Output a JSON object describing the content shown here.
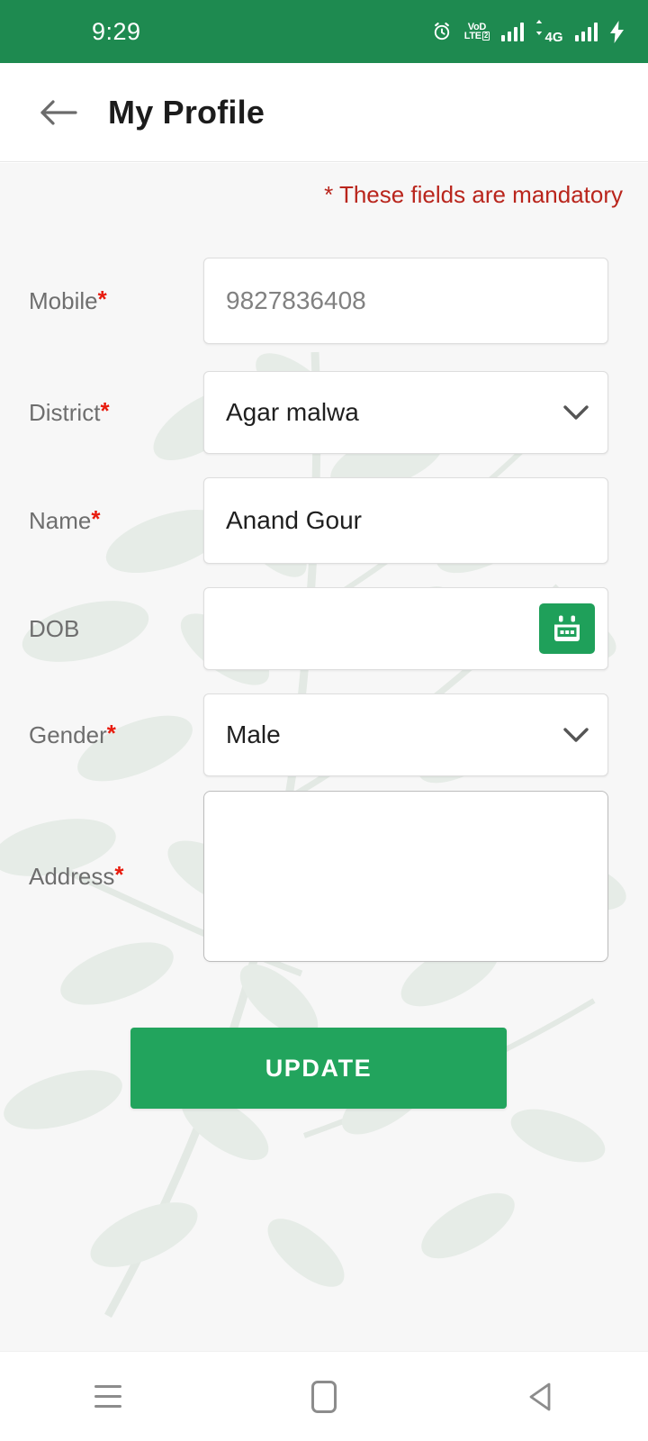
{
  "status_bar": {
    "time": "9:29",
    "background_color": "#1e8a50",
    "icons": [
      {
        "name": "alarm-icon",
        "label": "alarm"
      },
      {
        "name": "volte-icon",
        "label": "VoLTE",
        "line1": "VoD",
        "line2": "LTE",
        "badge": "2"
      },
      {
        "name": "signal-bars-sim1-icon",
        "label": "signal"
      },
      {
        "name": "network-4g-icon",
        "label": "4G"
      },
      {
        "name": "signal-bars-sim2-icon",
        "label": "signal"
      },
      {
        "name": "battery-charging-icon",
        "label": "charging"
      }
    ]
  },
  "app_bar": {
    "back_label": "back",
    "title": "My Profile"
  },
  "content": {
    "mandatory_note": "* These fields are mandatory",
    "note_color": "#b9251c"
  },
  "form": {
    "fields": [
      {
        "key": "mobile",
        "label": "Mobile",
        "required": true,
        "type": "text",
        "value": "9827836408",
        "placeholder": "",
        "disabled": true
      },
      {
        "key": "district",
        "label": "District",
        "required": true,
        "type": "select",
        "value": "Agar malwa",
        "placeholder": "",
        "disabled": false
      },
      {
        "key": "name",
        "label": "Name",
        "required": true,
        "type": "text",
        "value": "Anand Gour",
        "placeholder": "",
        "disabled": false
      },
      {
        "key": "dob",
        "label": "DOB",
        "required": false,
        "type": "date",
        "value": "",
        "placeholder": "",
        "disabled": false,
        "button_icon": "calendar-icon"
      },
      {
        "key": "gender",
        "label": "Gender",
        "required": true,
        "type": "select",
        "value": "Male",
        "placeholder": "",
        "disabled": false
      },
      {
        "key": "address",
        "label": "Address",
        "required": true,
        "type": "textarea",
        "value": "",
        "placeholder": "",
        "disabled": false
      }
    ],
    "required_marker": "*"
  },
  "actions": {
    "update_label": "UPDATE",
    "update_color": "#22a45d"
  },
  "nav_bar": {
    "recents_label": "recents",
    "home_label": "home",
    "back_label": "back"
  }
}
